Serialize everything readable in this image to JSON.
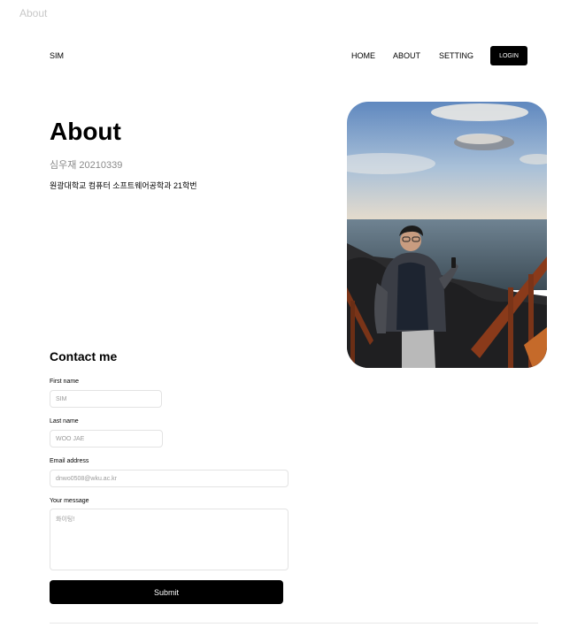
{
  "window": {
    "tab_title": "About"
  },
  "header": {
    "brand": "SIM",
    "nav": [
      "HOME",
      "ABOUT",
      "SETTING"
    ],
    "login_label": "LOGIN"
  },
  "hero": {
    "title": "About",
    "subtitle": "심우재 20210339",
    "description": "원광대학교  컴퓨터 소프트웨어공학과 21학번"
  },
  "contact": {
    "heading": "Contact me",
    "first_name": {
      "label": "First name",
      "value": "SIM"
    },
    "last_name": {
      "label": "Last name",
      "value": "WOO JAE"
    },
    "email": {
      "label": "Email address",
      "value": "dnwo0508@wku.ac.kr"
    },
    "message": {
      "label": "Your message",
      "value": "화이팅!"
    },
    "submit_label": "Submit"
  },
  "colors": {
    "accent": "#000000",
    "muted_text": "#8a8a8a",
    "border": "#e3e3e3"
  },
  "icons": {
    "photo": "profile-photo-seaside"
  }
}
